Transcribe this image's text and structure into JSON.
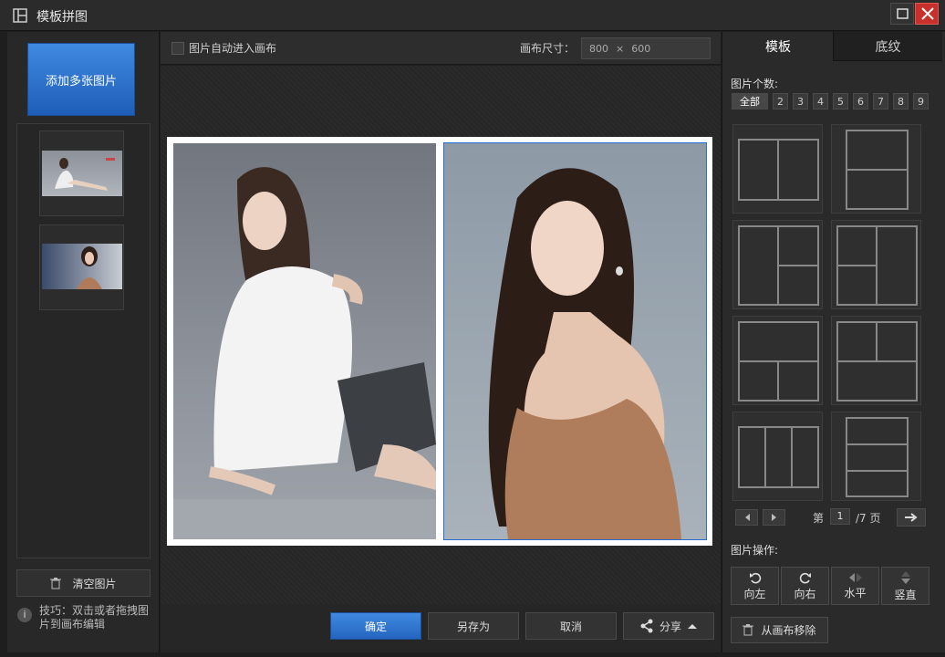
{
  "window": {
    "title": "模板拼图"
  },
  "left": {
    "add_button": "添加多张图片",
    "clear_button": "清空图片",
    "tip_icon": "i",
    "tip": "技巧：双击或者拖拽图片到画布编辑"
  },
  "toolbar": {
    "auto_label": "图片自动进入画布",
    "size_label": "画布尺寸：",
    "width": "800",
    "times": "×",
    "height": "600"
  },
  "bottom": {
    "ok": "确定",
    "save_as": "另存为",
    "cancel": "取消",
    "share": "分享"
  },
  "right": {
    "tabs": [
      "模板",
      "底纹"
    ],
    "count_label": "图片个数:",
    "counts": [
      "全部",
      "2",
      "3",
      "4",
      "5",
      "6",
      "7",
      "8",
      "9"
    ],
    "page_prefix": "第",
    "page_current": "1",
    "page_total": "/7 页",
    "ops_label": "图片操作:",
    "ops": [
      "向左",
      "向右",
      "水平",
      "竖直"
    ],
    "remove": "从画布移除"
  },
  "colors": {
    "accent": "#2a6fd0",
    "close": "#c8312b"
  }
}
